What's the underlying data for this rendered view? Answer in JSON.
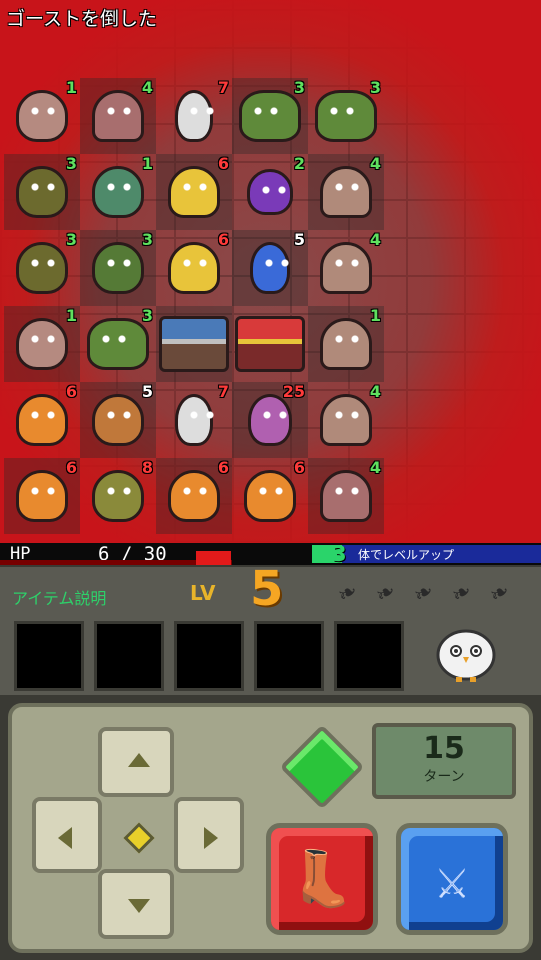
{
  "message": "ゴーストを倒した",
  "grid": [
    [
      {
        "kind": "slime-pink",
        "n": "1",
        "c": "g"
      },
      {
        "kind": "ghost",
        "n": "4",
        "c": "g"
      },
      {
        "kind": "skeleton",
        "n": "7",
        "c": "r"
      },
      {
        "kind": "frog",
        "n": "3",
        "c": "g"
      },
      {
        "kind": "frog",
        "n": "3",
        "c": "g"
      }
    ],
    [
      {
        "kind": "blob-olive",
        "n": "3",
        "c": "g"
      },
      {
        "kind": "eye-green",
        "n": "1",
        "c": "g"
      },
      {
        "kind": "yellow",
        "n": "6",
        "c": "r"
      },
      {
        "kind": "purple",
        "n": "2",
        "c": "g"
      },
      {
        "kind": "hood",
        "n": "4",
        "c": "g"
      }
    ],
    [
      {
        "kind": "blob-olive",
        "n": "3",
        "c": "g"
      },
      {
        "kind": "green-blob",
        "n": "3",
        "c": "g"
      },
      {
        "kind": "yellow",
        "n": "6",
        "c": "r"
      },
      {
        "kind": "knight",
        "n": "5",
        "c": "w"
      },
      {
        "kind": "hood",
        "n": "4",
        "c": "g"
      }
    ],
    [
      {
        "kind": "slime-pink",
        "n": "1",
        "c": "g"
      },
      {
        "kind": "frog",
        "n": "3",
        "c": "g"
      },
      {
        "kind": "chest",
        "n": "",
        "c": "g"
      },
      {
        "kind": "chest red",
        "n": "",
        "c": "g"
      },
      {
        "kind": "hood",
        "n": "1",
        "c": "g"
      }
    ],
    [
      {
        "kind": "orange",
        "n": "6",
        "c": "r"
      },
      {
        "kind": "monkey",
        "n": "5",
        "c": "w"
      },
      {
        "kind": "skeleton",
        "n": "7",
        "c": "r"
      },
      {
        "kind": "fairy",
        "n": "25",
        "c": "r"
      },
      {
        "kind": "hood",
        "n": "4",
        "c": "g"
      }
    ],
    [
      {
        "kind": "orange",
        "n": "6",
        "c": "r"
      },
      {
        "kind": "goblin",
        "n": "8",
        "c": "r"
      },
      {
        "kind": "orange",
        "n": "6",
        "c": "r"
      },
      {
        "kind": "orange",
        "n": "6",
        "c": "r"
      },
      {
        "kind": "ghost",
        "n": "4",
        "c": "g"
      }
    ]
  ],
  "status": {
    "hp_label": "HP",
    "hp_value": "6 / 30",
    "hp_fraction": 0.2,
    "xp_remaining": "3",
    "xp_text": "体でレベルアップ",
    "xp_fraction": 0.1
  },
  "panel": {
    "item_desc": "アイテム説明",
    "lv_label": "LV",
    "lv_value": "5",
    "feathers": 5,
    "slots": 5
  },
  "controller": {
    "turn_value": "15",
    "turn_label": "ターン"
  },
  "colors": {
    "hp": "#e21a1a",
    "xp": "#2ad46a",
    "level": "#f5a623"
  }
}
